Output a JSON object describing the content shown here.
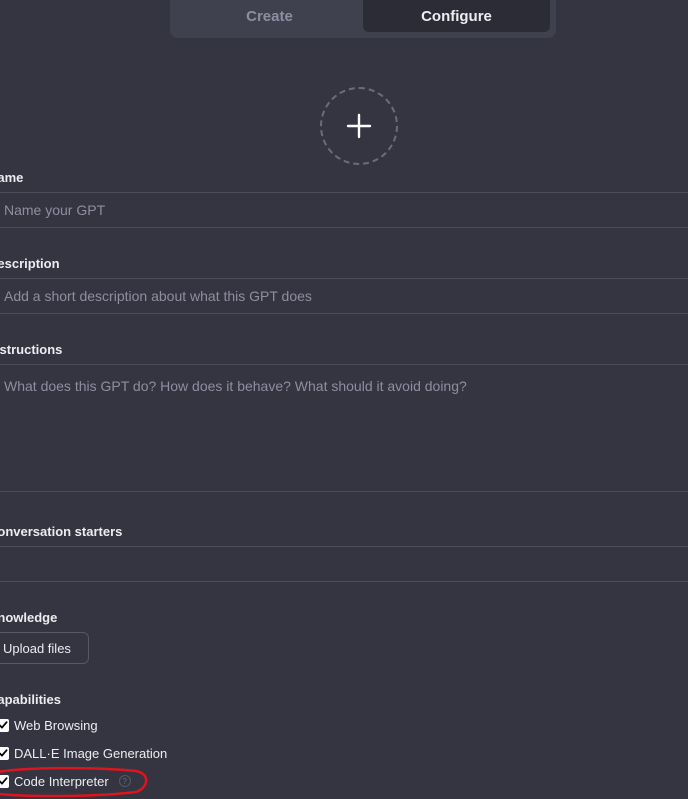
{
  "tabs": [
    {
      "label": "Create",
      "active": false
    },
    {
      "label": "Configure",
      "active": true
    }
  ],
  "avatar": {
    "icon": "plus-icon"
  },
  "fields": {
    "name": {
      "label": "Name",
      "placeholder": "Name your GPT",
      "value": ""
    },
    "description": {
      "label": "Description",
      "placeholder": "Add a short description about what this GPT does",
      "value": ""
    },
    "instructions": {
      "label": "Instructions",
      "placeholder": "What does this GPT do? How does it behave? What should it avoid doing?",
      "value": ""
    },
    "conversation_starters": {
      "label": "Conversation starters",
      "placeholder": "",
      "value": ""
    }
  },
  "knowledge": {
    "label": "Knowledge",
    "upload_label": "Upload files"
  },
  "capabilities": {
    "label": "Capabilities",
    "items": [
      {
        "label": "Web Browsing",
        "checked": true
      },
      {
        "label": "DALL·E Image Generation",
        "checked": true
      },
      {
        "label": "Code Interpreter",
        "checked": true,
        "help": "?"
      }
    ]
  },
  "colors": {
    "background": "#343541",
    "annotation": "#e0141e"
  }
}
